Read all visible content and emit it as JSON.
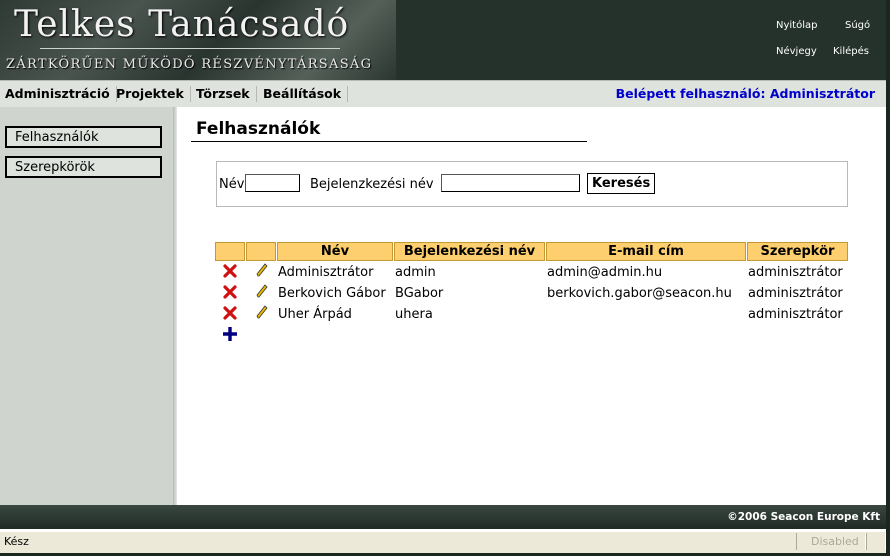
{
  "header": {
    "logo_title": "Telkes Tanácsadó",
    "logo_subtitle": "ZÁRTKÖRŰEN MŰKÖDŐ RÉSZVÉNYTÁRSASÁG",
    "links": {
      "home": "Nyitólap",
      "help": "Súgó",
      "vcard": "Névjegy",
      "logout": "Kilépés"
    }
  },
  "menu": {
    "items": [
      "Adminisztráció",
      "Projektek",
      "Törzsek",
      "Beállítások"
    ],
    "logged_in": "Belépett felhasználó: Adminisztrátor"
  },
  "sidebar": {
    "items": [
      {
        "label": "Felhasználók"
      },
      {
        "label": "Szerepkörök"
      }
    ]
  },
  "main": {
    "title": "Felhasználók",
    "search": {
      "name_label": "Név",
      "name_value": "",
      "login_label": "Bejelenzkezési név",
      "login_value": "",
      "button": "Keresés"
    },
    "table": {
      "columns": [
        "Név",
        "Bejelenkezési név",
        "E-mail cím",
        "Szerepkör"
      ],
      "rows": [
        {
          "name": "Adminisztrátor",
          "login": "admin",
          "email": "admin@admin.hu",
          "role": "adminisztrátor"
        },
        {
          "name": "Berkovich Gábor",
          "login": "BGabor",
          "email": "berkovich.gabor@seacon.hu",
          "role": "adminisztrátor"
        },
        {
          "name": "Uher Árpád",
          "login": "uhera",
          "email": "",
          "role": "adminisztrátor"
        }
      ]
    }
  },
  "footer": {
    "copyright": "©2006 Seacon Europe Kft"
  },
  "statusbar": {
    "text": "Kész",
    "mode": "Disabled"
  },
  "icons": {
    "delete": "delete-icon",
    "edit": "pencil-icon",
    "add": "plus-icon"
  },
  "colors": {
    "header_bg": "#25322b",
    "table_header": "#fecf6e",
    "logged_in": "#0000cc",
    "sidebar_bg": "#cfd4cf"
  }
}
